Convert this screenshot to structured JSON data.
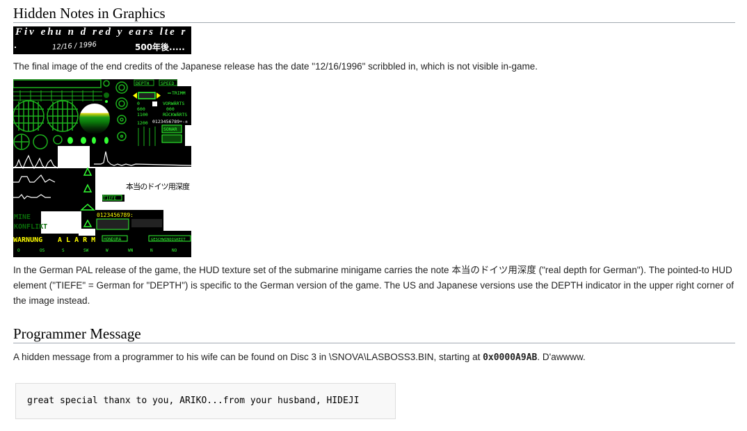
{
  "section1": {
    "heading": "Hidden Notes in Graphics",
    "credits_image": {
      "line1": "Fiv ehu n d red y ears  lte r",
      "date_scribble": "12/16 / 1996",
      "japanese_text": "500年後....."
    },
    "caption1": "The final image of the end credits of the Japanese release has the date \"12/16/1996\" scribbled in, which is not visible in-game.",
    "hud_image": {
      "labels": {
        "depth": "DEPTH",
        "speed": "SPEED",
        "trimm": "TRIMM",
        "vorwaerts": "VORWÄRTS",
        "zero_speed": "000",
        "rueckwaerts": "RÜCKWÄRTS",
        "gauge_ticks": [
          "0",
          "600",
          "1100",
          "1200"
        ],
        "digits": "0123456789+-±",
        "sonar": "SONAR",
        "tiefe": "TIEFE",
        "handwritten_note": "本当のドイツ用深度",
        "digits_yellow": "0123456789:",
        "mine": "MINE",
        "konflikt": "KONFLIKT",
        "warnung": "WARNUNG",
        "alarm": "A L A R M",
        "hondura": "HONDURA",
        "geschwindigkeit": "GESCHWINDIGKEIT",
        "compass": [
          "O",
          "OS",
          "S",
          "SW",
          "W",
          "WN",
          "N",
          "NO"
        ]
      }
    },
    "caption2_before": "In the German PAL release of the game, the HUD texture set of the submarine minigame carries the note ",
    "caption2_jp": "本当のドイツ用深度",
    "caption2_after": " (\"real depth for German\"). The pointed-to HUD element (\"TIEFE\" = German for \"DEPTH\") is specific to the German version of the game. The US and Japanese versions use the DEPTH indicator in the upper right corner of the image instead."
  },
  "section2": {
    "heading": "Programmer Message",
    "text_before": "A hidden message from a programmer to his wife can be found on Disc 3 in \\SNOVA\\LASBOSS3.BIN, starting at ",
    "offset": "0x0000A9AB",
    "text_after": ". D'awwww.",
    "message": "great special thanx to you, ARIKO...from your husband, HIDEJI"
  }
}
